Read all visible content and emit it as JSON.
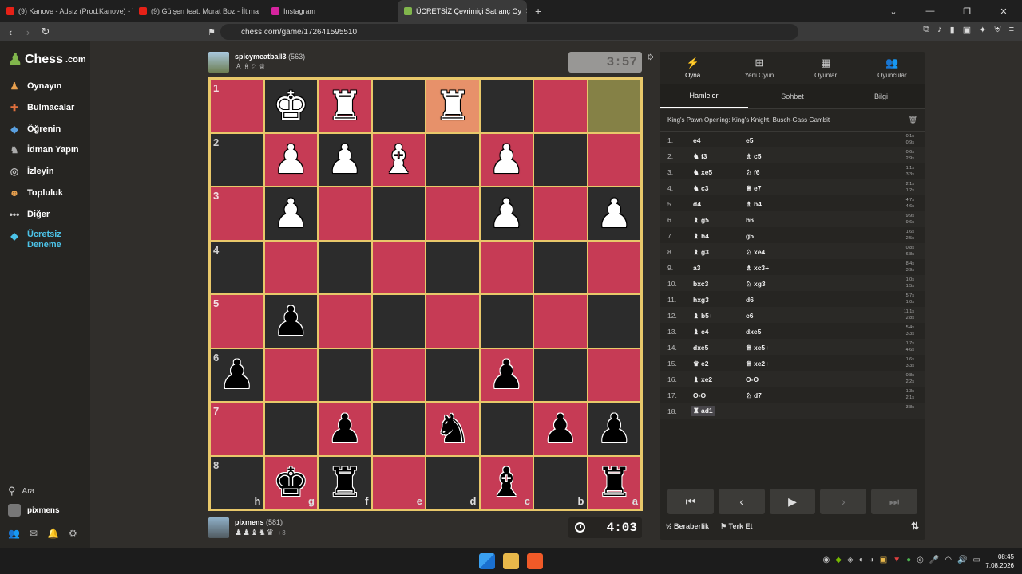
{
  "browser": {
    "tabs": [
      {
        "title": "(9) Kanove - Adsız (Prod.Kanove) - Yo",
        "color": "#e62117"
      },
      {
        "title": "(9) Gülşen feat. Murat Boz - İltima",
        "color": "#e62117"
      },
      {
        "title": "Instagram",
        "color": "#d6249f"
      },
      {
        "title": "ÜCRETSİZ Çevrimiçi Satranç Oy",
        "color": "#81b64c"
      }
    ],
    "new_tab": "+",
    "url": "chess.com/game/172641595510"
  },
  "sidebar": {
    "logo": "Chess",
    "logo_suffix": ".com",
    "items": [
      {
        "label": "Oynayın",
        "icon": "play-icon",
        "color": "#e8a04e"
      },
      {
        "label": "Bulmacalar",
        "icon": "puzzle-icon",
        "color": "#e0703d"
      },
      {
        "label": "Öğrenin",
        "icon": "learn-icon",
        "color": "#5aa0e0"
      },
      {
        "label": "İdman Yapın",
        "icon": "train-icon",
        "color": "#aaaaaa"
      },
      {
        "label": "İzleyin",
        "icon": "watch-icon",
        "color": "#bbbbbb"
      },
      {
        "label": "Topluluk",
        "icon": "community-icon",
        "color": "#e8a04e"
      },
      {
        "label": "Diğer",
        "icon": "more-icon",
        "color": "#cccccc"
      }
    ],
    "trial_line1": "Ücretsiz",
    "trial_line2": "Deneme",
    "search": "Ara",
    "user": "pixmens"
  },
  "top_player": {
    "name": "spicymeatball3",
    "rating": "(563)",
    "captured": "♙♗♘♕",
    "clock": "3:57"
  },
  "bottom_player": {
    "name": "pixmens",
    "rating": "(581)",
    "captured": "♟♟♝♞♛",
    "plus": "+3",
    "clock": "4:03"
  },
  "board": {
    "ranks": [
      "1",
      "2",
      "3",
      "4",
      "5",
      "6",
      "7",
      "8"
    ],
    "files": [
      "h",
      "g",
      "f",
      "e",
      "d",
      "c",
      "b",
      "a"
    ],
    "rows": [
      [
        "",
        "wK",
        "wR",
        "",
        "wR",
        "",
        "",
        ""
      ],
      [
        "",
        "wP",
        "wP",
        "wB",
        "",
        "wP",
        "",
        ""
      ],
      [
        "",
        "wP",
        "",
        "",
        "",
        "wP",
        "",
        "wP"
      ],
      [
        "",
        "",
        "",
        "",
        "",
        "",
        "",
        ""
      ],
      [
        "",
        "bP",
        "",
        "",
        "",
        "",
        "",
        ""
      ],
      [
        "bP",
        "",
        "",
        "",
        "",
        "bP",
        "",
        ""
      ],
      [
        "",
        "",
        "bP",
        "",
        "bN",
        "",
        "bP",
        "bP"
      ],
      [
        "",
        "bK",
        "bR",
        "",
        "",
        "bB",
        "",
        "bR"
      ]
    ]
  },
  "panel": {
    "tabs": [
      {
        "label": "Oyna",
        "icon": "⚡"
      },
      {
        "label": "Yeni Oyun",
        "icon": "⊞"
      },
      {
        "label": "Oyunlar",
        "icon": "▦"
      },
      {
        "label": "Oyuncular",
        "icon": "👥"
      }
    ],
    "subtabs": [
      "Hamleler",
      "Sohbet",
      "Bilgi"
    ],
    "opening": "King's Pawn Opening: King's Knight, Busch-Gass Gambit",
    "moves": [
      {
        "n": "1.",
        "w": "e4",
        "b": "e5",
        "tw": "0.1s",
        "tb": "0.9s"
      },
      {
        "n": "2.",
        "w": "♞ f3",
        "b": "♗ c5",
        "tw": "0.6s",
        "tb": "2.9s"
      },
      {
        "n": "3.",
        "w": "♞ xe5",
        "b": "♘ f6",
        "tw": "1.1s",
        "tb": "3.3s"
      },
      {
        "n": "4.",
        "w": "♞ c3",
        "b": "♕ e7",
        "tw": "2.1s",
        "tb": "1.2s"
      },
      {
        "n": "5.",
        "w": "d4",
        "b": "♗ b4",
        "tw": "4.7s",
        "tb": "4.6s"
      },
      {
        "n": "6.",
        "w": "♝ g5",
        "b": "h6",
        "tw": "9.9s",
        "tb": "9.6s"
      },
      {
        "n": "7.",
        "w": "♝ h4",
        "b": "g5",
        "tw": "1.6s",
        "tb": "2.5s"
      },
      {
        "n": "8.",
        "w": "♝ g3",
        "b": "♘ xe4",
        "tw": "0.8s",
        "tb": "6.8s"
      },
      {
        "n": "9.",
        "w": "a3",
        "b": "♗ xc3+",
        "tw": "8.4s",
        "tb": "3.9s"
      },
      {
        "n": "10.",
        "w": "bxc3",
        "b": "♘ xg3",
        "tw": "1.0s",
        "tb": "1.5s"
      },
      {
        "n": "11.",
        "w": "hxg3",
        "b": "d6",
        "tw": "5.7s",
        "tb": "1.0s"
      },
      {
        "n": "12.",
        "w": "♝ b5+",
        "b": "c6",
        "tw": "11.1s",
        "tb": "2.8s"
      },
      {
        "n": "13.",
        "w": "♝ c4",
        "b": "dxe5",
        "tw": "5.4s",
        "tb": "3.3s"
      },
      {
        "n": "14.",
        "w": "dxe5",
        "b": "♕ xe5+",
        "tw": "1.7s",
        "tb": "4.6s"
      },
      {
        "n": "15.",
        "w": "♛ e2",
        "b": "♕ xe2+",
        "tw": "1.6s",
        "tb": "3.3s"
      },
      {
        "n": "16.",
        "w": "♝ xe2",
        "b": "O-O",
        "tw": "0.8s",
        "tb": "2.2s"
      },
      {
        "n": "17.",
        "w": "O-O",
        "b": "♘ d7",
        "tw": "1.3s",
        "tb": "2.1s"
      },
      {
        "n": "18.",
        "w": "♜ ad1",
        "b": "",
        "tw": "3.8s",
        "tb": ""
      }
    ],
    "controls": [
      "⏮",
      "‹",
      "▶",
      "›",
      "⏭"
    ],
    "draw": "Beraberlik",
    "draw_icon": "½",
    "resign": "Terk Et"
  },
  "taskbar": {
    "time": "08:45",
    "date": "7.08.2026"
  }
}
